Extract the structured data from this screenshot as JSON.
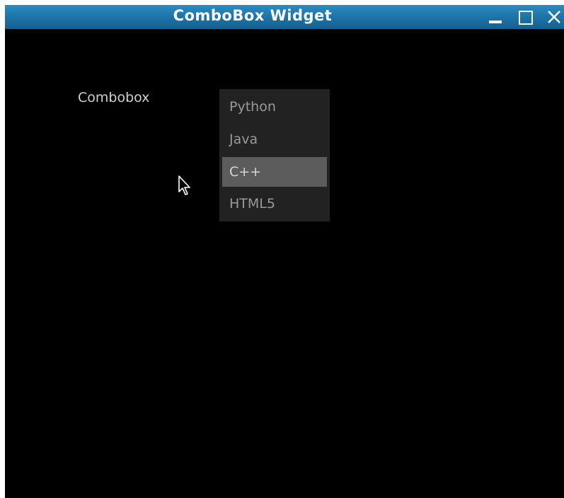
{
  "window": {
    "title": "ComboBox Widget",
    "titlebar_color": "#1f76aa",
    "background_color": "#000000",
    "controls": [
      "minimize-icon",
      "maximize-icon",
      "close-icon"
    ]
  },
  "form": {
    "label": "Combobox"
  },
  "combobox": {
    "options": [
      {
        "label": "Python"
      },
      {
        "label": "Java"
      },
      {
        "label": "C++"
      },
      {
        "label": "HTML5"
      }
    ],
    "highlighted": "C++",
    "highlight_color": "#5c5c5c"
  },
  "cursor": {
    "icon": "arrow-cursor-icon"
  }
}
